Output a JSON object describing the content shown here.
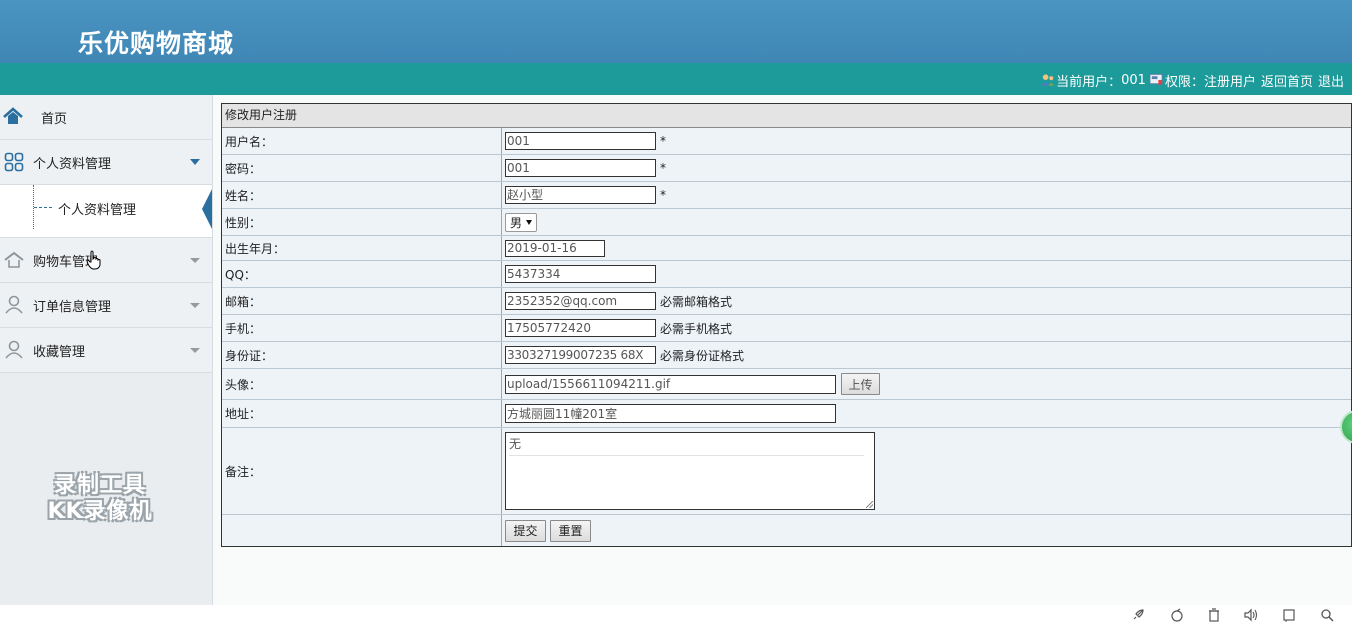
{
  "header": {
    "site_title": "乐优购物商城",
    "current_user_label": "当前用户：",
    "current_user": "001",
    "role_label": "权限：",
    "role": "注册用户",
    "home_link": "返回首页",
    "logout_link": "退出"
  },
  "sidebar": {
    "home": "首页",
    "profile_mgmt": "个人资料管理",
    "profile_sub": "个人资料管理",
    "cart_mgmt": "购物车管理",
    "order_mgmt": "订单信息管理",
    "favorites_mgmt": "收藏管理"
  },
  "watermark": {
    "line1": "录制工具",
    "line2": "KK录像机"
  },
  "form": {
    "title": "修改用户注册",
    "required_mark": "*",
    "fields": {
      "username": {
        "label": "用户名：",
        "value": "001"
      },
      "password": {
        "label": "密码：",
        "value": "001"
      },
      "name": {
        "label": "姓名：",
        "value": "赵小型"
      },
      "gender": {
        "label": "性别：",
        "value": "男"
      },
      "birthdate": {
        "label": "出生年月：",
        "value": "2019-01-16"
      },
      "qq": {
        "label": "QQ：",
        "value": "5437334"
      },
      "email": {
        "label": "邮箱：",
        "value": "2352352@qq.com",
        "hint": "必需邮箱格式"
      },
      "phone": {
        "label": "手机：",
        "value": "17505772420",
        "hint": "必需手机格式"
      },
      "idcard": {
        "label": "身份证：",
        "value": "330327199007235 68X",
        "hint": "必需身份证格式"
      },
      "avatar": {
        "label": "头像：",
        "value": "upload/1556611094211.gif",
        "upload_button": "上传"
      },
      "address": {
        "label": "地址：",
        "value": "方城丽圆11幢201室"
      },
      "remark": {
        "label": "备注：",
        "value": "无"
      }
    },
    "submit_button": "提交",
    "reset_button": "重置"
  },
  "colors": {
    "header_blue": "#4a95c1",
    "teal_bar": "#1d9a9a",
    "sidebar_bg": "#e9edf0",
    "icon_blue": "#2a6fa0"
  }
}
